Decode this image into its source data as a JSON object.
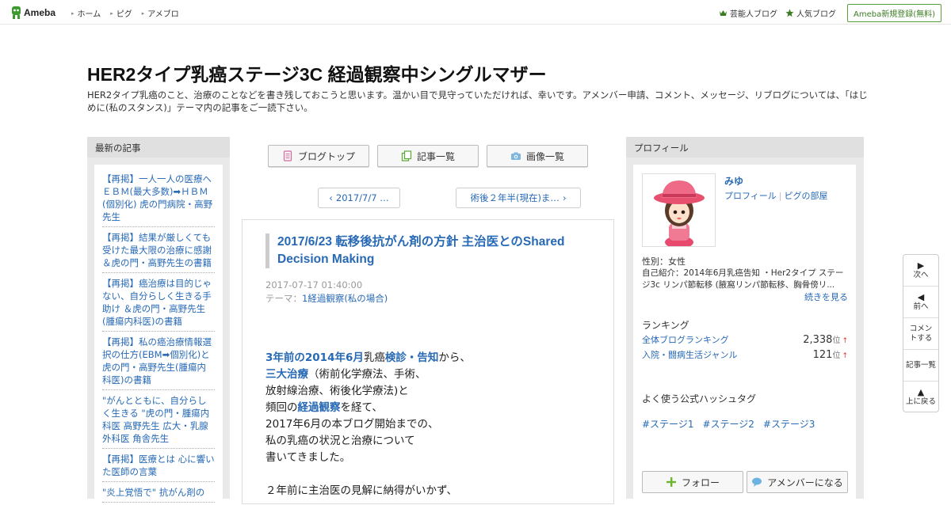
{
  "header": {
    "logo_text": "Ameba",
    "nav": [
      "ホーム",
      "ピグ",
      "アメブロ"
    ],
    "right_links": [
      "芸能人ブログ",
      "人気ブログ"
    ],
    "register_label": "Ameba新規登録(無料)"
  },
  "blog": {
    "title": "HER2タイプ乳癌ステージ3C 経過観察中シングルマザー",
    "description": "HER2タイプ乳癌のこと、治療のことなどを書き残しておこうと思います。温かい目で見守っていただければ、幸いです。アメンバー申請、コメント、メッセージ、リブログについては、「はじめに(私のスタンス)」テーマ内の記事をご一読下さい。"
  },
  "left_sidebar": {
    "heading": "最新の記事",
    "entries": [
      "【再掲】一人一人の医療へ ＥＢＭ(最大多数)➡ＨＢＭ(個別化) 虎の門病院・高野先生",
      "【再掲】結果が厳しくても受けた最大限の治療に感謝 ＆虎の門・高野先生の書籍",
      "【再掲】癌治療は目的じゃない、自分らしく生きる手助け ＆虎の門・高野先生(腫瘍内科医)の書籍",
      "【再掲】私の癌治療情報選択の仕方(EBM➡個別化)と虎の門・高野先生(腫瘍内科医)の書籍",
      "\"がんとともに、自分らしく生きる \"虎の門・腫瘍内科医 高野先生 広大・乳腺外科医 角舎先生",
      "【再掲】医療とは 心に響いた医師の言葉",
      "\"炎上覚悟で\" 抗がん剤の"
    ]
  },
  "center": {
    "buttons": [
      "ブログトップ",
      "記事一覧",
      "画像一覧"
    ],
    "prev_label": "2017/7/7 …",
    "next_label": "術後２年半(現在)ま…",
    "article": {
      "title": "2017/6/23 転移後抗がん剤の方針 主治医とのShared Decision Making",
      "date": "2017-07-17 01:40:00",
      "theme_label": "テーマ：",
      "theme": "1経過観察(私の場合)",
      "body_lines": [
        [
          {
            "t": "3年前の2014年6月",
            "h": true
          },
          {
            "t": "乳癌",
            "h": false
          },
          {
            "t": "検診・告知",
            "h": true
          },
          {
            "t": "から、",
            "h": false
          }
        ],
        [
          {
            "t": "三大治療",
            "h": true
          },
          {
            "t": "（術前化学療法、手術、",
            "h": false
          }
        ],
        [
          {
            "t": "放射線治療、術後化学療法)と",
            "h": false
          }
        ],
        [
          {
            "t": "頻回の",
            "h": false
          },
          {
            "t": "経過観察",
            "h": true
          },
          {
            "t": "を経て、",
            "h": false
          }
        ],
        [
          {
            "t": "2017年6月の本ブログ開始までの、",
            "h": false
          }
        ],
        [
          {
            "t": "私の乳癌の状況と治療について",
            "h": false
          }
        ],
        [
          {
            "t": "書いてきました。",
            "h": false
          }
        ],
        [
          {
            "t": "",
            "h": false
          }
        ],
        [
          {
            "t": "２年前に主治医の見解に納得がいかず、",
            "h": false
          }
        ]
      ]
    }
  },
  "right_sidebar": {
    "heading": "プロフィール",
    "name": "みゆ",
    "link_profile": "プロフィール",
    "link_pig": "ピグの部屋",
    "sex": "性別：女性",
    "self_intro": "自己紹介：2014年6月乳癌告知 ・Her2タイプ ステージ3c リンパ節転移 (腋窩リンパ節転移、胸骨傍リ...",
    "more": "続きを見る",
    "ranking_heading": "ランキング",
    "rankings": [
      {
        "name": "全体ブログランキング",
        "value": "2,338",
        "unit": "位",
        "arrow": "↑"
      },
      {
        "name": "入院・闘病生活ジャンル",
        "value": "121",
        "unit": "位",
        "arrow": "↑"
      }
    ],
    "hashtag_heading": "よく使う公式ハッシュタグ",
    "hashtags": [
      "#ステージ1",
      "#ステージ2",
      "#ステージ3"
    ],
    "follow_label": "フォロー",
    "amember_label": "アメンバーになる"
  },
  "float_nav": [
    {
      "label": "次へ",
      "icon": "arrow-right-icon",
      "glyph": "▶"
    },
    {
      "label": "前へ",
      "icon": "arrow-left-icon",
      "glyph": "◀"
    },
    {
      "label": "コメントする",
      "icon": "",
      "glyph": ""
    },
    {
      "label": "記事一覧",
      "icon": "",
      "glyph": ""
    },
    {
      "label": "上に戻る",
      "icon": "arrow-up-icon",
      "glyph": "▲"
    }
  ],
  "colors": {
    "link": "#2769b5",
    "accent_green": "#3c7d24"
  }
}
